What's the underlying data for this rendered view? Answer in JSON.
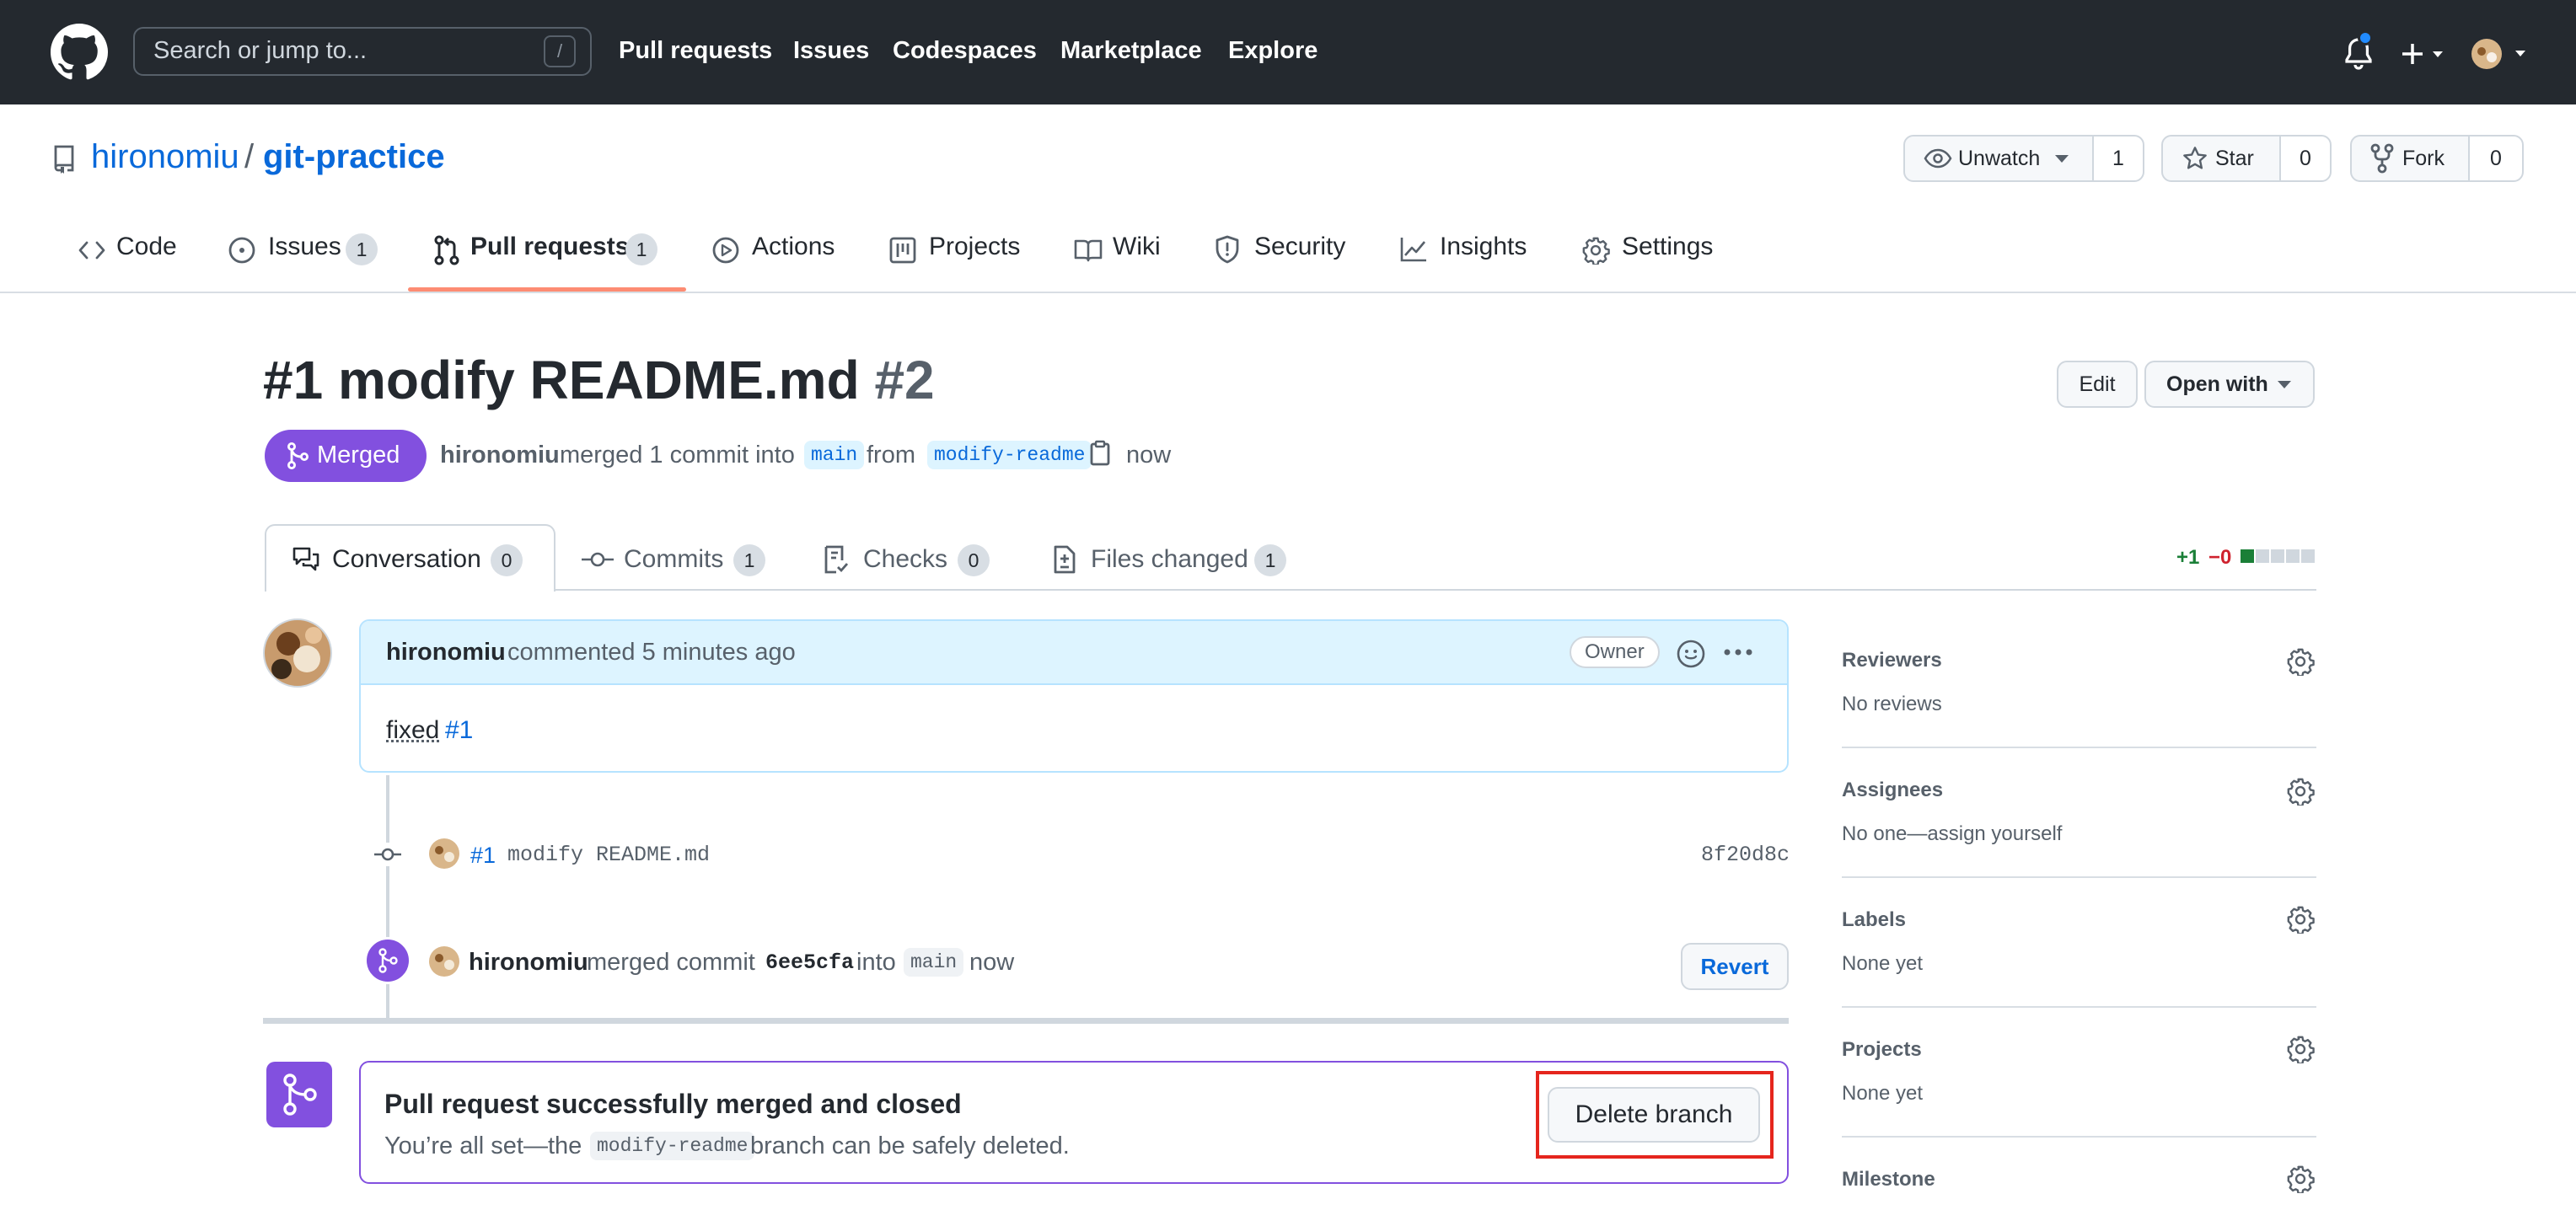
{
  "header": {
    "search_placeholder": "Search or jump to...",
    "search_shortcut": "/",
    "nav": [
      "Pull requests",
      "Issues",
      "Codespaces",
      "Marketplace",
      "Explore"
    ]
  },
  "repo": {
    "owner": "hironomiu",
    "separator": "/",
    "name": "git-practice",
    "unwatch_label": "Unwatch",
    "watch_count": "1",
    "star_label": "Star",
    "star_count": "0",
    "fork_label": "Fork",
    "fork_count": "0"
  },
  "repo_tabs": {
    "code": "Code",
    "issues": "Issues",
    "issues_count": "1",
    "pull_requests": "Pull requests",
    "pull_requests_count": "1",
    "actions": "Actions",
    "projects": "Projects",
    "wiki": "Wiki",
    "security": "Security",
    "insights": "Insights",
    "settings": "Settings"
  },
  "pr": {
    "title": "#1 modify README.md",
    "number": "#2",
    "edit_label": "Edit",
    "open_with_label": "Open with",
    "state": "Merged",
    "author": "hironomiu",
    "merge_text": "merged 1 commit into",
    "base_branch": "main",
    "from_text": "from",
    "head_branch": "modify-readme",
    "time": "now"
  },
  "pr_tabs": {
    "conversation": "Conversation",
    "conversation_count": "0",
    "commits": "Commits",
    "commits_count": "1",
    "checks": "Checks",
    "checks_count": "0",
    "files_changed": "Files changed",
    "files_changed_count": "1",
    "additions": "+1",
    "deletions": "−0",
    "diffstat": [
      1,
      0,
      0,
      0,
      0
    ]
  },
  "comment": {
    "author": "hironomiu",
    "action": "commented 5 minutes ago",
    "badge": "Owner",
    "body_text": "fixed",
    "body_link": "#1"
  },
  "commit_event": {
    "issue_ref": "#1",
    "message": "modify README.md",
    "sha": "8f20d8c"
  },
  "merge_event": {
    "author": "hironomiu",
    "text_before": "merged commit",
    "sha": "6ee5cfa",
    "text_into": "into",
    "branch": "main",
    "time": "now",
    "revert_label": "Revert"
  },
  "merged_box": {
    "title": "Pull request successfully merged and closed",
    "desc_before": "You’re all set—the",
    "branch": "modify-readme",
    "desc_after": "branch can be safely deleted.",
    "delete_label": "Delete branch"
  },
  "sidebar": {
    "reviewers_title": "Reviewers",
    "reviewers_value": "No reviews",
    "assignees_title": "Assignees",
    "assignees_value": "No one—assign yourself",
    "labels_title": "Labels",
    "labels_value": "None yet",
    "projects_title": "Projects",
    "projects_value": "None yet",
    "milestone_title": "Milestone"
  },
  "colors": {
    "header_bg": "#24292f",
    "link": "#0969da",
    "merged_purple": "#8250df",
    "add_green": "#1a7f37",
    "del_red": "#cf222e",
    "highlight_red": "#e5251d"
  }
}
